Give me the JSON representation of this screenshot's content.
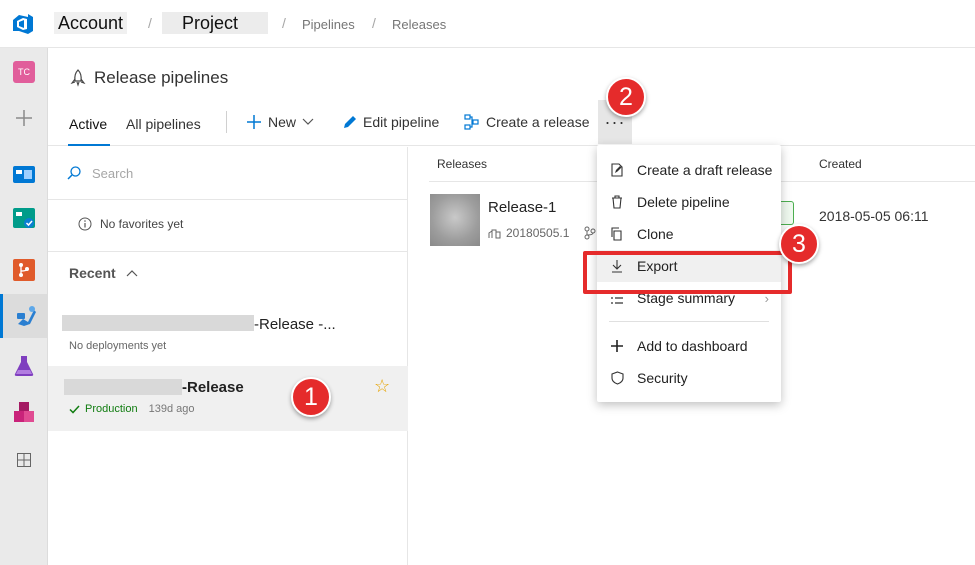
{
  "breadcrumb": {
    "account": "Account",
    "project": "Project",
    "pipelines": "Pipelines",
    "releases": "Releases",
    "separator": "/"
  },
  "nav": {
    "avatar_initials": "TC"
  },
  "header": {
    "title": "Release pipelines",
    "tabs": [
      {
        "label": "Active"
      },
      {
        "label": "All pipelines"
      }
    ],
    "new_label": "New",
    "edit_label": "Edit pipeline",
    "create_release_label": "Create a release",
    "more_label": "···"
  },
  "left_panel": {
    "search_placeholder": "Search",
    "no_favorites": "No favorites yet",
    "recent_label": "Recent",
    "pipelines": [
      {
        "name_suffix": "-Release -...",
        "status": "No deployments yet"
      },
      {
        "name_suffix": "-Release",
        "env": "Production",
        "age": "139d ago"
      }
    ]
  },
  "releases_table": {
    "col_releases": "Releases",
    "col_created": "Created",
    "rows": [
      {
        "name": "Release-1",
        "build": "20180505.1",
        "created": "2018-05-05 06:11"
      }
    ]
  },
  "menu": {
    "items": [
      {
        "label": "Create a draft release",
        "icon": "draft-icon"
      },
      {
        "label": "Delete pipeline",
        "icon": "trash-icon"
      },
      {
        "label": "Clone",
        "icon": "clone-icon"
      },
      {
        "label": "Export",
        "icon": "download-icon"
      },
      {
        "label": "Stage summary",
        "icon": "list-icon"
      },
      {
        "label": "Add to dashboard",
        "icon": "plus-icon"
      },
      {
        "label": "Security",
        "icon": "shield-icon"
      }
    ]
  },
  "annotations": {
    "step1": "1",
    "step2": "2",
    "step3": "3"
  },
  "colors": {
    "accent": "#0078d4",
    "callout": "#e52b2b",
    "success": "#107c10"
  }
}
